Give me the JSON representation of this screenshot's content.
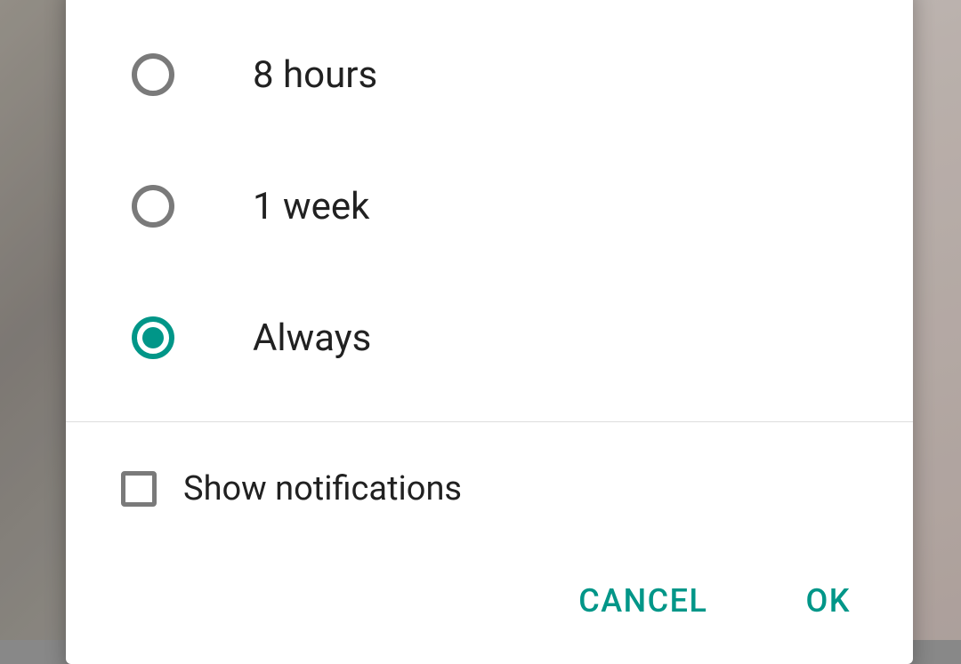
{
  "dialog": {
    "options": [
      {
        "label": "8 hours",
        "selected": false
      },
      {
        "label": "1 week",
        "selected": false
      },
      {
        "label": "Always",
        "selected": true
      }
    ],
    "checkbox": {
      "label": "Show notifications",
      "checked": false
    },
    "actions": {
      "cancel": "CANCEL",
      "ok": "OK"
    }
  }
}
